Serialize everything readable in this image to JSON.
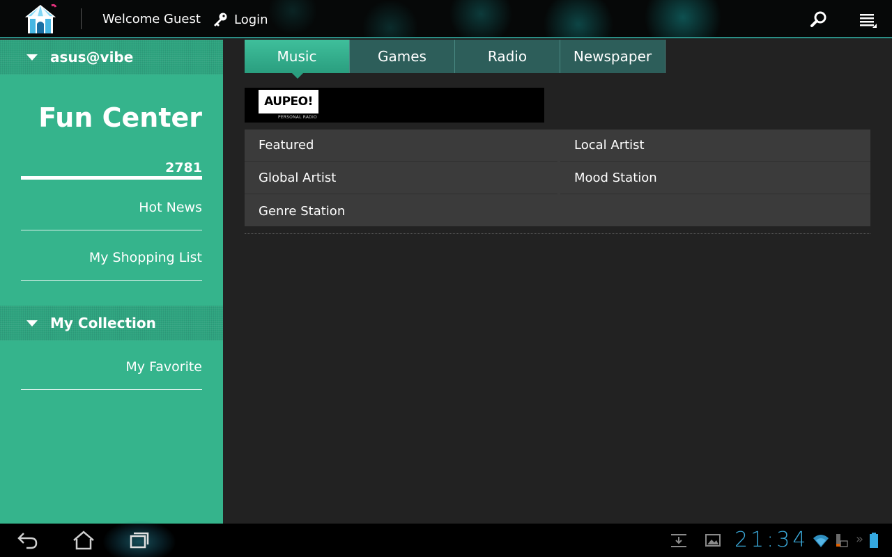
{
  "topbar": {
    "welcome_text": "Welcome Guest",
    "login_label": "Login",
    "icons": [
      "tent-logo-icon",
      "key-icon",
      "search-icon",
      "menu-icon"
    ]
  },
  "sidebar": {
    "section1_title": "asus@vibe",
    "fun_center_title": "Fun Center",
    "fun_center_count": "2781",
    "items": [
      {
        "label": "Hot News"
      },
      {
        "label": "My Shopping List"
      }
    ],
    "section2_title": "My Collection",
    "collection_items": [
      {
        "label": "My Favorite"
      }
    ],
    "accent_color": "#35b48c"
  },
  "main": {
    "tabs": [
      {
        "label": "Music",
        "active": true
      },
      {
        "label": "Games",
        "active": false
      },
      {
        "label": "Radio",
        "active": false
      },
      {
        "label": "Newspaper",
        "active": false
      }
    ],
    "banner": {
      "brand": "AUPEO!",
      "tagline": "PERSONAL RADIO"
    },
    "categories": [
      {
        "label": "Featured"
      },
      {
        "label": "Local Artist"
      },
      {
        "label": "Global Artist"
      },
      {
        "label": "Mood Station"
      },
      {
        "label": "Genre Station"
      }
    ]
  },
  "navbar": {
    "time": "21:34",
    "icons": [
      "back-icon",
      "home-icon",
      "recent-apps-icon",
      "download-icon",
      "gallery-icon",
      "wifi-icon",
      "keyboard-battery-icon",
      "battery-icon"
    ]
  }
}
